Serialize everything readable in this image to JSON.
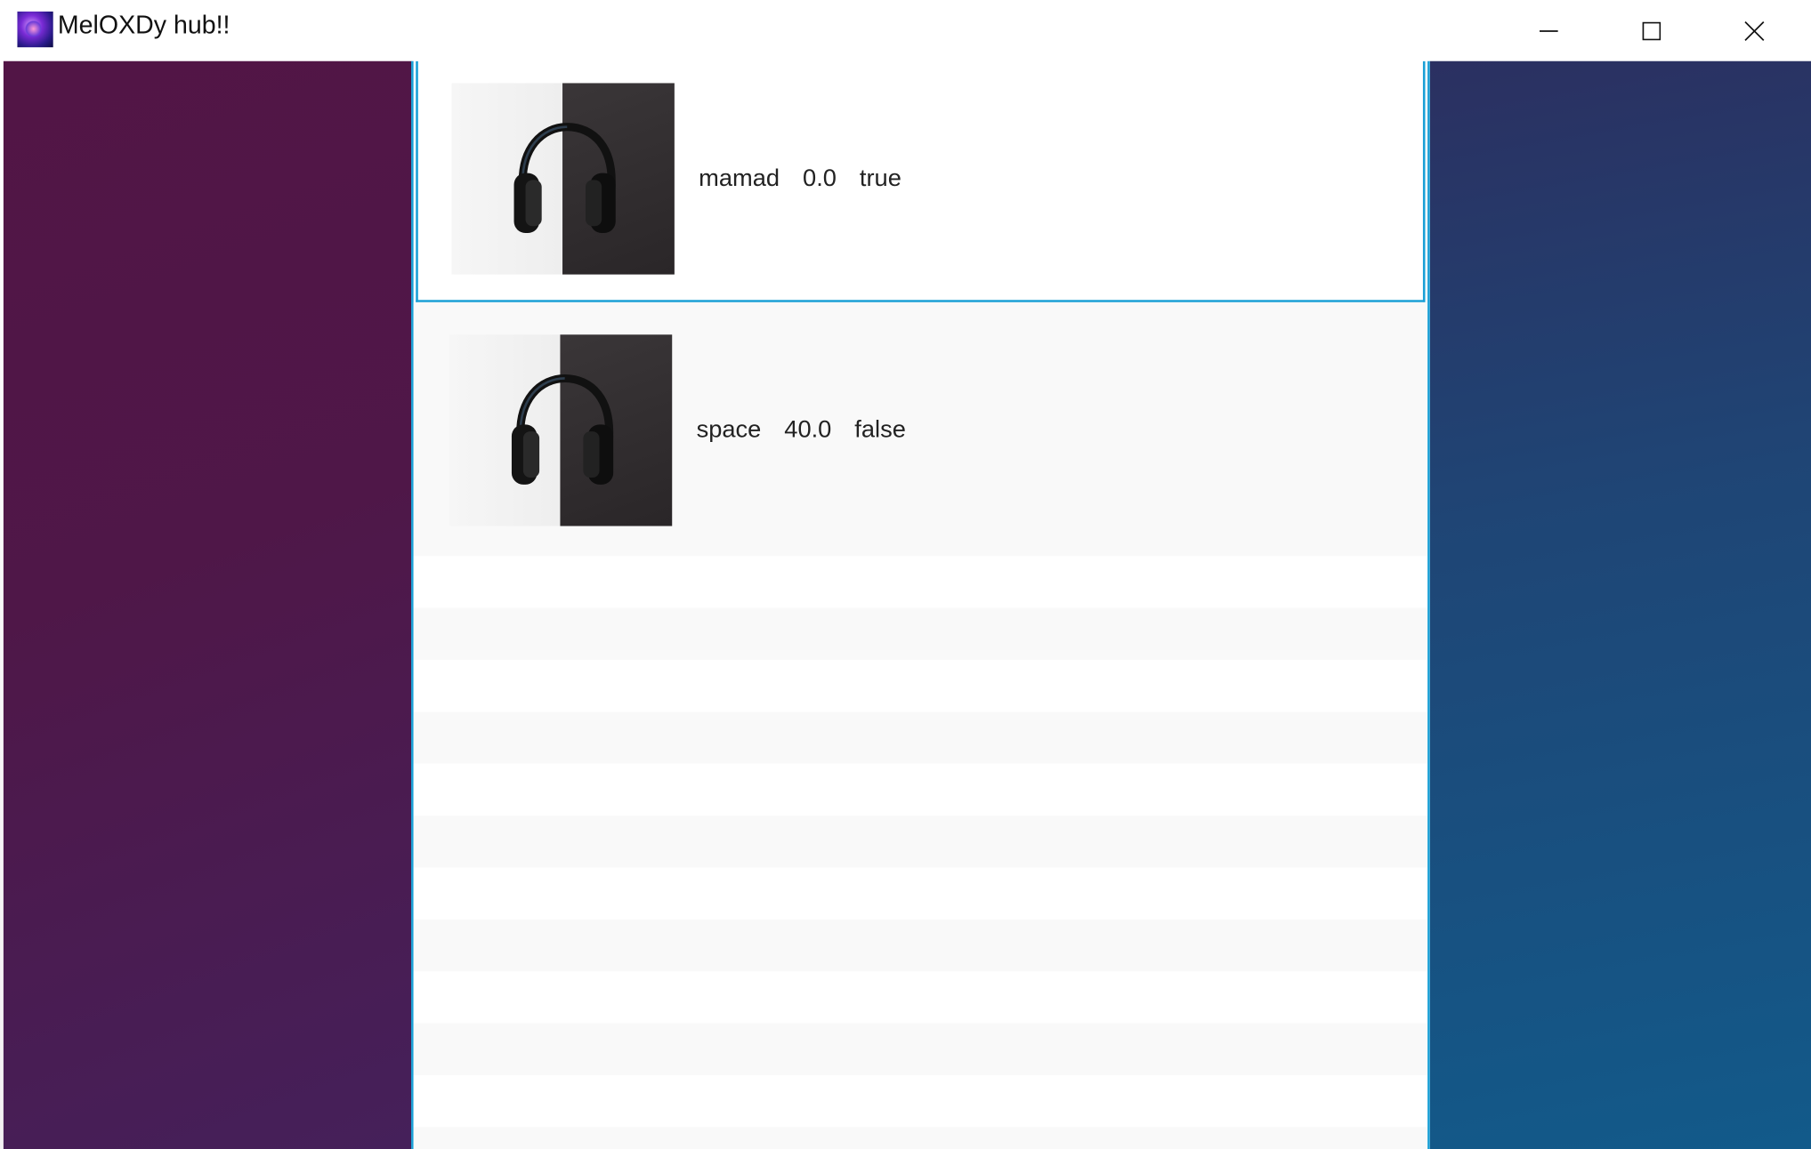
{
  "window": {
    "title": "MelOXDy hub!!",
    "icons": {
      "app": "app-logo-icon",
      "minimize": "minimize-icon",
      "maximize": "maximize-icon",
      "close": "close-icon"
    }
  },
  "colors": {
    "selection_border": "#1aa0d6",
    "left_background": "#521546",
    "right_background": "#1f4575"
  },
  "tracks": [
    {
      "name": "mamad",
      "value": "0.0",
      "flag": "true",
      "cover_icon": "headphones-icon",
      "selected": true
    },
    {
      "name": "space",
      "value": "40.0",
      "flag": "false",
      "cover_icon": "headphones-icon",
      "selected": false
    }
  ]
}
